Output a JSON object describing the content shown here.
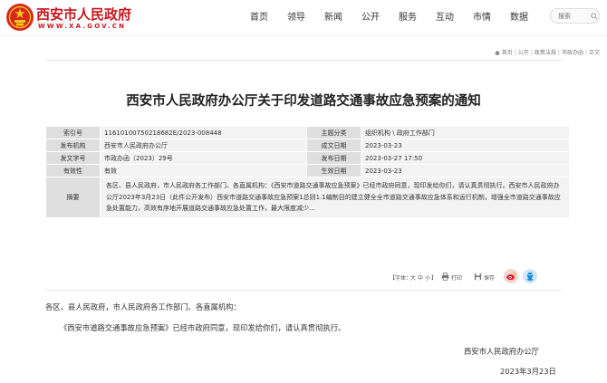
{
  "header": {
    "site_title": "西安市人民政府",
    "site_url": "WWW.XA.GOV.CN",
    "brand_color": "#c8161d",
    "nav": [
      "首页",
      "领导",
      "新闻",
      "公开",
      "服务",
      "互动",
      "市情",
      "数据"
    ],
    "search_placeholder": "搜索"
  },
  "breadcrumb": {
    "items": [
      "首页",
      "公开",
      "政策法规",
      "市政办函",
      "正文"
    ],
    "separator": "|"
  },
  "page_title": "西安市人民政府办公厅关于印发道路交通事故应急预案的通知",
  "meta": {
    "index_no_label": "索引号",
    "index_no": "11610100750218682E/2023-008448",
    "topic_label": "主题分类",
    "topic": "组织机构 \\ 政府工作部门",
    "issuer_label": "发布机构",
    "issuer": "西安市人民政府办公厅",
    "written_date_label": "成文日期",
    "written_date": "2023-03-23",
    "doc_no_label": "发文字号",
    "doc_no": "市政办函（2023）29号",
    "publish_date_label": "发布日期",
    "publish_date": "2023-03-27 17:50",
    "validity_label": "有效性",
    "validity": "有效",
    "effective_date_label": "生效日期",
    "effective_date": "2023-03-23",
    "abstract_label": "摘要",
    "abstract": "各区、县人民政府，市人民政府各工作部门、各直属机构：《西安市道路交通事故应急预案》已经市政府同意，现印发给你们，请认真贯彻执行。西安市人民政府办公厅2023年3月23日（此件公开发布）西安市道路交通事故应急预案1总则1.1编制目的建立健全全市道路交通事故应急体系和运行机制，增强全市道路交通事故应急处置能力，高效有序地开展道路交通事故应急处置工作，最大限度减少..."
  },
  "tools": {
    "font_label": "【字体：",
    "font_options": [
      "大",
      "中",
      "小"
    ],
    "font_end": "】",
    "print_label": "打印",
    "save_label": "保存"
  },
  "body": {
    "salutation": "各区、县人民政府，市人民政府各工作部门、各直属机构：",
    "paragraph": "《西安市道路交通事故应急预案》已经市政府同意，现印发给你们，请认真贯彻执行。",
    "signature": "西安市人民政府办公厅",
    "date": "2023年3月23日"
  }
}
